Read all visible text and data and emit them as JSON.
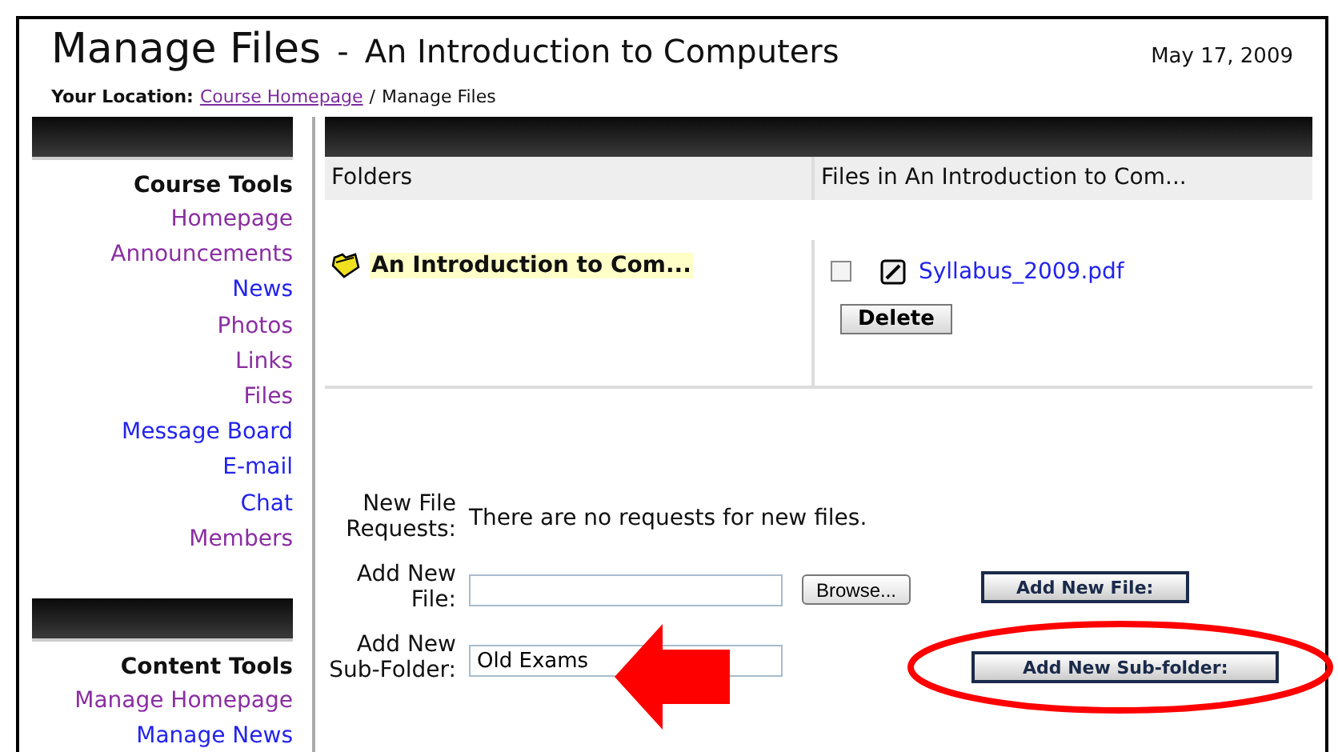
{
  "header": {
    "title": "Manage Files",
    "separator": "-",
    "course": "An Introduction to Computers",
    "date": "May 17, 2009"
  },
  "location": {
    "label": "Your Location:",
    "link": "Course Homepage",
    "separator": "/",
    "current": "Manage Files"
  },
  "sidebar": [
    {
      "heading": "Course Tools",
      "items": [
        {
          "label": "Homepage",
          "visited": true
        },
        {
          "label": "Announcements",
          "visited": true
        },
        {
          "label": "News",
          "visited": false
        },
        {
          "label": "Photos",
          "visited": true
        },
        {
          "label": "Links",
          "visited": true
        },
        {
          "label": "Files",
          "visited": true
        },
        {
          "label": "Message Board",
          "visited": false
        },
        {
          "label": "E-mail",
          "visited": false
        },
        {
          "label": "Chat",
          "visited": false
        },
        {
          "label": "Members",
          "visited": true
        }
      ]
    },
    {
      "heading": "Content Tools",
      "items": [
        {
          "label": "Manage Homepage",
          "visited": true
        },
        {
          "label": "Manage News",
          "visited": false
        }
      ]
    }
  ],
  "folders": {
    "heading": "Folders",
    "items": [
      {
        "name": "An Introduction to Com...",
        "selected": true
      }
    ]
  },
  "files": {
    "heading": "Files in An Introduction to Com...",
    "items": [
      {
        "name": "Syllabus_2009.pdf",
        "checked": false
      }
    ],
    "delete_button": "Delete"
  },
  "form": [
    {
      "kind": "text",
      "label": "New File Requests:",
      "text": "There are no requests for new files."
    },
    {
      "kind": "file",
      "label": "Add New File:",
      "browse_button": "Browse...",
      "action_button": "Add New File:"
    },
    {
      "kind": "input",
      "label": "Add New Sub-Folder:",
      "value": "Old Exams",
      "action_button": "Add New Sub-folder:"
    }
  ]
}
